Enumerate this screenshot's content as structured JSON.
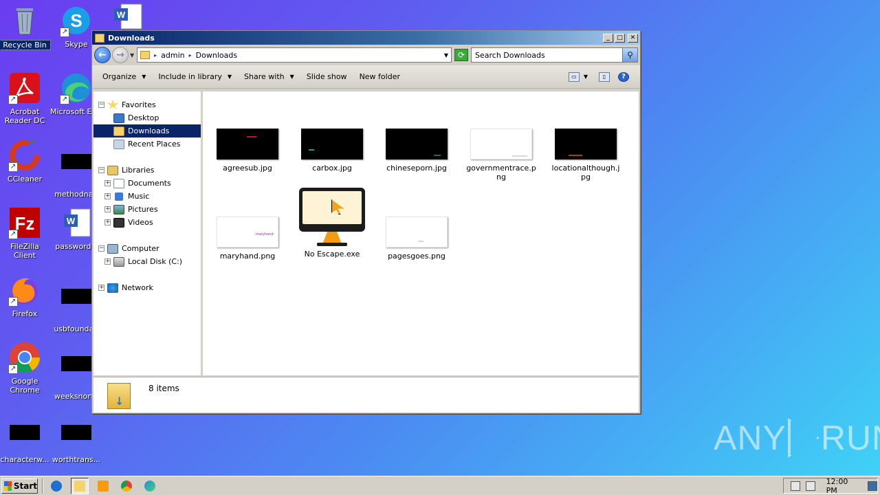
{
  "desktop": {
    "icons": [
      {
        "label": "Recycle Bin"
      },
      {
        "label": "Skype"
      },
      {
        "label": "Acrobat Reader DC"
      },
      {
        "label": "Microsoft Edge"
      },
      {
        "label": "CCleaner"
      },
      {
        "label": "methodnati"
      },
      {
        "label": "FileZilla Client"
      },
      {
        "label": "passwords."
      },
      {
        "label": "Firefox"
      },
      {
        "label": "usbfoundati"
      },
      {
        "label": "Google Chrome"
      },
      {
        "label": "weeksnorth"
      },
      {
        "label": "characterw..."
      },
      {
        "label": "worthtrans..."
      }
    ]
  },
  "window": {
    "title": "Downloads",
    "address": {
      "crumbs": [
        "admin",
        "Downloads"
      ]
    },
    "search_placeholder": "Search Downloads",
    "toolbar": {
      "organize": "Organize",
      "include": "Include in library",
      "share": "Share with",
      "slideshow": "Slide show",
      "newfolder": "New folder"
    },
    "nav": {
      "favorites": "Favorites",
      "desktop": "Desktop",
      "downloads": "Downloads",
      "recent": "Recent Places",
      "libraries": "Libraries",
      "documents": "Documents",
      "music": "Music",
      "pictures": "Pictures",
      "videos": "Videos",
      "computer": "Computer",
      "localdisk": "Local Disk (C:)",
      "network": "Network"
    },
    "files": [
      {
        "name": "agreesub.jpg"
      },
      {
        "name": "carbox.jpg"
      },
      {
        "name": "chineseporn.jpg"
      },
      {
        "name": "governmentrace.png"
      },
      {
        "name": "locationalthough.jpg"
      },
      {
        "name": "maryhand.png",
        "thumb_text": "maryhand"
      },
      {
        "name": "No Escape.exe"
      },
      {
        "name": "pagesgoes.png"
      }
    ],
    "status": {
      "count": "8 items"
    }
  },
  "taskbar": {
    "start": "Start",
    "clock": "12:00 PM"
  },
  "watermark": {
    "left": "ANY",
    "right": "RUN"
  },
  "colors": {
    "title_bar": "#0a246a",
    "selection": "#0a246a",
    "desktop_start": "#6a3df0",
    "desktop_end": "#3fd4f6"
  }
}
